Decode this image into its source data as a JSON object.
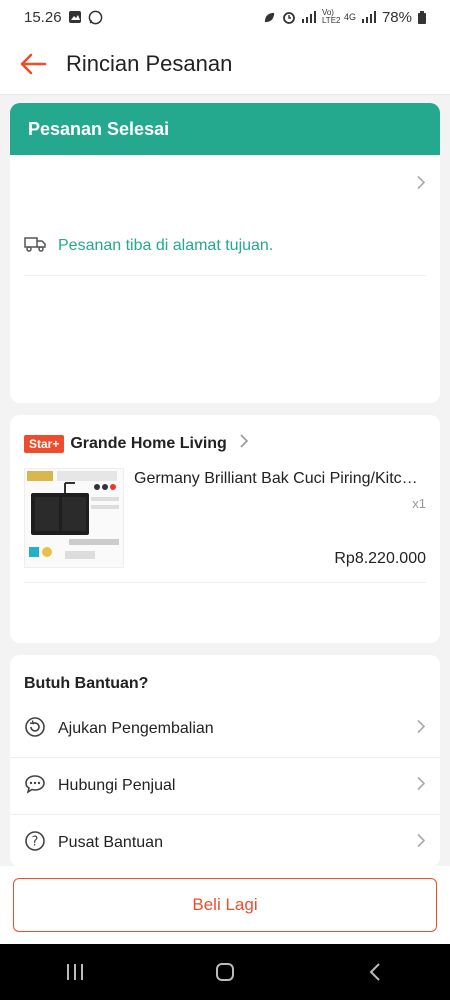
{
  "status_bar": {
    "time": "15.26",
    "battery": "78%",
    "network_1": "Vo) LTE2",
    "network_2": "4G"
  },
  "header": {
    "title": "Rincian Pesanan"
  },
  "order_status": {
    "banner": "Pesanan Selesai",
    "delivery_text": "Pesanan tiba di alamat tujuan."
  },
  "shop": {
    "badge": "Star+",
    "name": "Grande Home Living",
    "product": {
      "name": "Germany Brilliant Bak Cuci Piring/Kitchen Sink",
      "quantity": "x1",
      "price": "Rp8.220.000"
    }
  },
  "help": {
    "title": "Butuh Bantuan?",
    "items": [
      {
        "label": "Ajukan Pengembalian",
        "icon": "return-icon"
      },
      {
        "label": "Hubungi Penjual",
        "icon": "chat-icon"
      },
      {
        "label": "Pusat Bantuan",
        "icon": "help-icon"
      }
    ]
  },
  "actions": {
    "buy_again": "Beli Lagi"
  },
  "colors": {
    "primary": "#ee4d2d",
    "status": "#24a98f"
  }
}
